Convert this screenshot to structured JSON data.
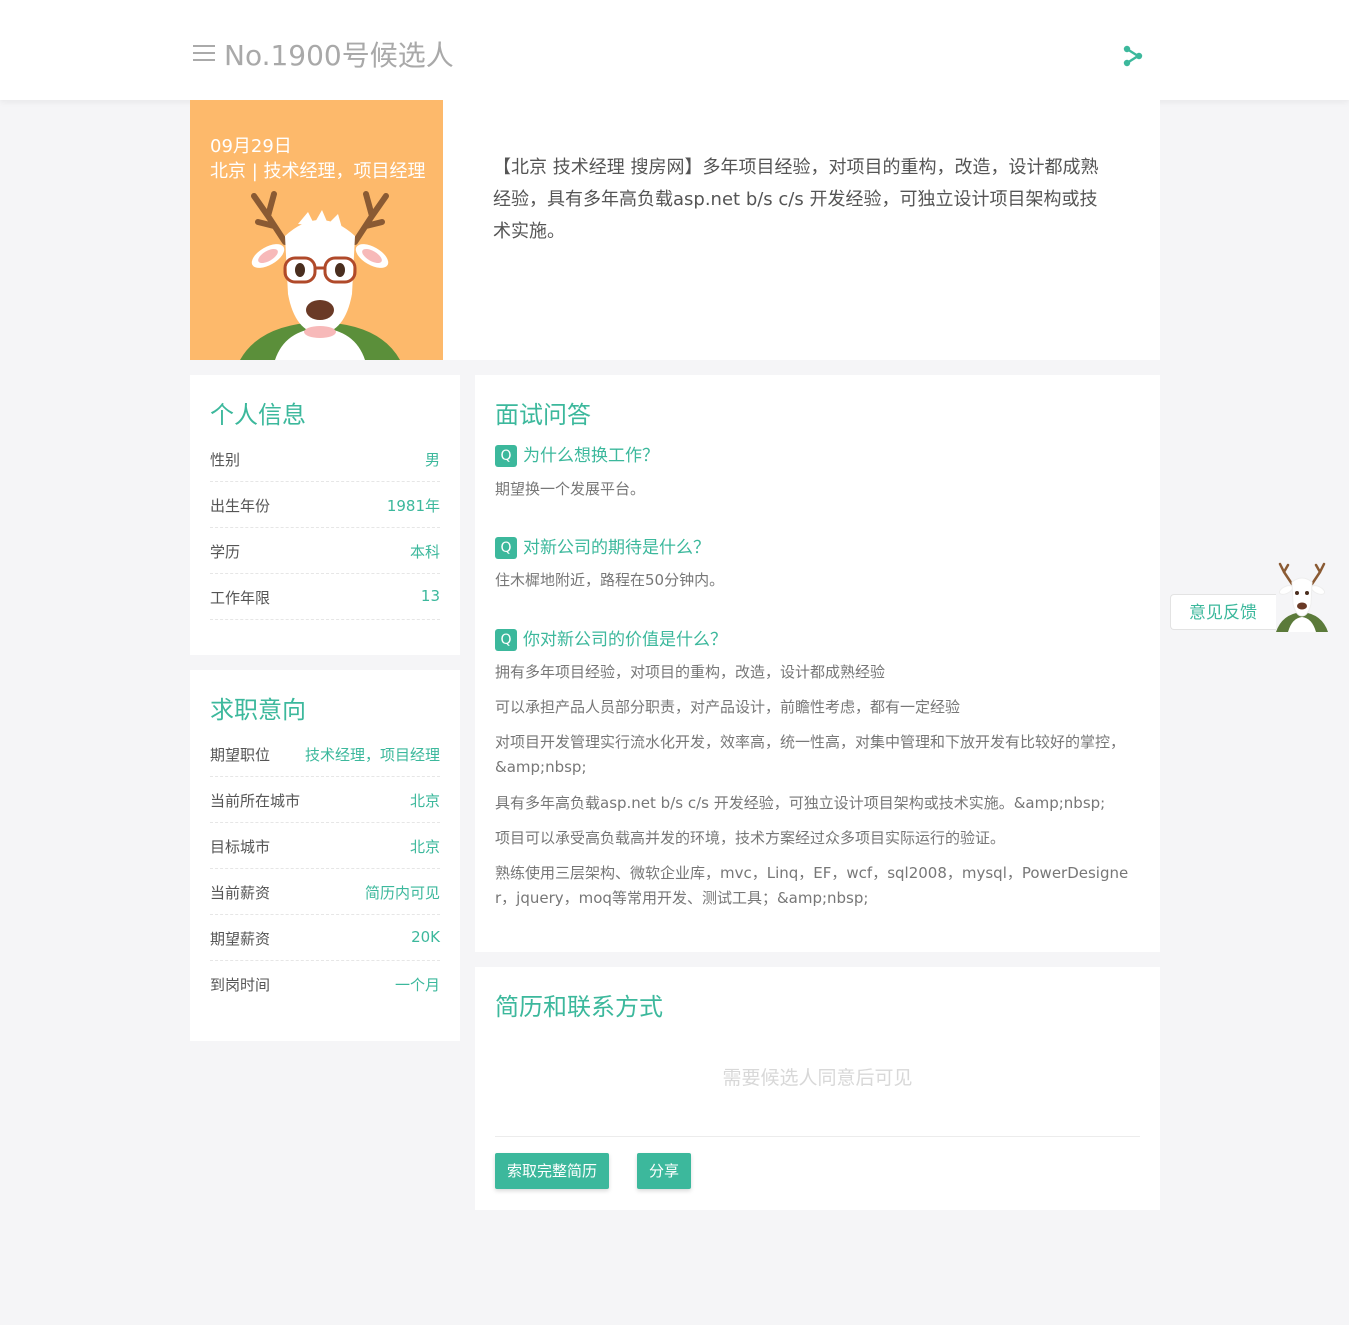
{
  "header": {
    "title": "No.1900号候选人"
  },
  "hero": {
    "date": "09月29日",
    "subtitle": "北京 | 技术经理，项目经理",
    "description": "【北京 技术经理 搜房网】多年项目经验，对项目的重构，改造，设计都成熟经验，具有多年高负载asp.net b/s c/s 开发经验，可独立设计项目架构或技术实施。"
  },
  "personal": {
    "title": "个人信息",
    "items": [
      {
        "label": "性别",
        "value": "男"
      },
      {
        "label": "出生年份",
        "value": "1981年"
      },
      {
        "label": "学历",
        "value": "本科"
      },
      {
        "label": "工作年限",
        "value": "13"
      }
    ]
  },
  "intent": {
    "title": "求职意向",
    "items": [
      {
        "label": "期望职位",
        "value": "技术经理，项目经理"
      },
      {
        "label": "当前所在城市",
        "value": "北京"
      },
      {
        "label": "目标城市",
        "value": "北京"
      },
      {
        "label": "当前薪资",
        "value": "简历内可见"
      },
      {
        "label": "期望薪资",
        "value": "20K"
      },
      {
        "label": "到岗时间",
        "value": "一个月"
      }
    ]
  },
  "interview": {
    "title": "面试问答",
    "badge": "Q",
    "q1": {
      "question": "为什么想换工作？",
      "answer": "期望换一个发展平台。"
    },
    "q2": {
      "question": "对新公司的期待是什么？",
      "answer": "住木樨地附近，路程在50分钟内。"
    },
    "q3": {
      "question": "你对新公司的价值是什么？",
      "answers": [
        "拥有多年项目经验，对项目的重构，改造，设计都成熟经验",
        "可以承担产品人员部分职责，对产品设计，前瞻性考虑，都有一定经验",
        "对项目开发管理实行流水化开发，效率高，统一性高，对集中管理和下放开发有比较好的掌控，&amp;nbsp;",
        "具有多年高负载asp.net b/s c/s 开发经验，可独立设计项目架构或技术实施。&amp;nbsp;",
        "项目可以承受高负载高并发的环境，技术方案经过众多项目实际运行的验证。",
        "熟练使用三层架构、微软企业库，mvc，Linq，EF，wcf，sql2008，mysql，PowerDesigner，jquery，moq等常用开发、测试工具；&amp;nbsp;"
      ]
    }
  },
  "resume": {
    "title": "简历和联系方式",
    "note": "需要候选人同意后可见",
    "request_button": "索取完整简历",
    "share_button": "分享"
  },
  "feedback": {
    "label": "意见反馈"
  },
  "colors": {
    "accent": "#3cb89c",
    "hero_bg": "#fdb96b",
    "page_bg": "#f5f5f7"
  },
  "icons": {
    "menu": "menu-icon",
    "share": "share-icon",
    "mascot": "deer-mascot"
  }
}
